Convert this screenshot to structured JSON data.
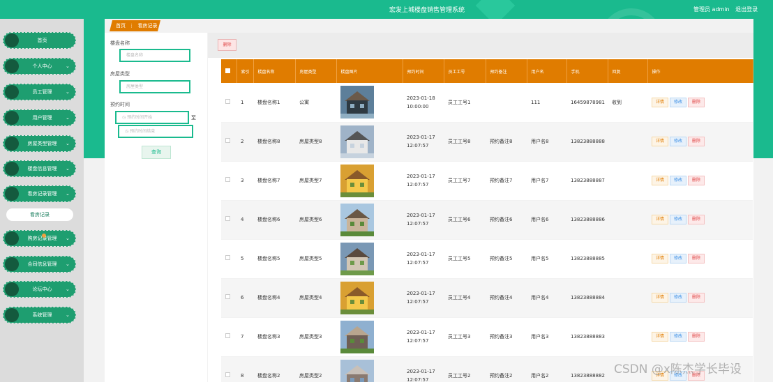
{
  "header": {
    "title": "宏发上城楼盘销售管理系统",
    "user_role": "管理员 admin",
    "logout": "退出登录"
  },
  "sidebar": {
    "items": [
      {
        "label": "首页",
        "has_chevron": false
      },
      {
        "label": "个人中心",
        "has_chevron": true
      },
      {
        "label": "员工管理",
        "has_chevron": true
      },
      {
        "label": "用户管理",
        "has_chevron": true
      },
      {
        "label": "房屋类型管理",
        "has_chevron": true
      },
      {
        "label": "楼盘信息管理",
        "has_chevron": true
      },
      {
        "label": "看房记录管理",
        "has_chevron": true
      },
      {
        "label": "购房记录管理",
        "has_chevron": true
      },
      {
        "label": "合同信息管理",
        "has_chevron": true
      },
      {
        "label": "论坛中心",
        "has_chevron": true
      },
      {
        "label": "系统管理",
        "has_chevron": true
      }
    ],
    "sub_item": "看房记录"
  },
  "breadcrumb": {
    "home": "首页",
    "separator": "⋮",
    "current": "看房记录"
  },
  "search": {
    "name_label": "楼盘名称",
    "name_placeholder": "楼盘名称",
    "type_label": "房屋类型",
    "type_placeholder": "房屋类型",
    "time_label": "预约时间",
    "time_start_placeholder": "预约时间开始",
    "time_to": "至",
    "time_end_placeholder": "预约时间结束",
    "button": "查询"
  },
  "toolbar": {
    "delete": "删除"
  },
  "table": {
    "headers": [
      "索引",
      "楼盘名称",
      "房屋类型",
      "楼盘图片",
      "预约时间",
      "员工工号",
      "预约备注",
      "用户名",
      "手机",
      "回复",
      "操作"
    ],
    "actions": {
      "detail": "详情",
      "edit": "修改",
      "delete": "删除"
    },
    "rows": [
      {
        "index": "1",
        "name": "楼盘名称1",
        "type": "公寓",
        "time": "2023-01-18 10:00:00",
        "staff": "员工工号1",
        "remark": "",
        "user": "111",
        "phone": "16459878981",
        "reply": "收到",
        "img": "img1"
      },
      {
        "index": "2",
        "name": "楼盘名称8",
        "type": "房屋类型8",
        "time": "2023-01-17 12:07:57",
        "staff": "员工工号8",
        "remark": "预约备注8",
        "user": "用户名8",
        "phone": "13823888888",
        "reply": "",
        "img": "img2"
      },
      {
        "index": "3",
        "name": "楼盘名称7",
        "type": "房屋类型7",
        "time": "2023-01-17 12:07:57",
        "staff": "员工工号7",
        "remark": "预约备注7",
        "user": "用户名7",
        "phone": "13823888887",
        "reply": "",
        "img": "img3"
      },
      {
        "index": "4",
        "name": "楼盘名称6",
        "type": "房屋类型6",
        "time": "2023-01-17 12:07:57",
        "staff": "员工工号6",
        "remark": "预约备注6",
        "user": "用户名6",
        "phone": "13823888886",
        "reply": "",
        "img": "img4"
      },
      {
        "index": "5",
        "name": "楼盘名称5",
        "type": "房屋类型5",
        "time": "2023-01-17 12:07:57",
        "staff": "员工工号5",
        "remark": "预约备注5",
        "user": "用户名5",
        "phone": "13823888885",
        "reply": "",
        "img": "img5"
      },
      {
        "index": "6",
        "name": "楼盘名称4",
        "type": "房屋类型4",
        "time": "2023-01-17 12:07:57",
        "staff": "员工工号4",
        "remark": "预约备注4",
        "user": "用户名4",
        "phone": "13823888884",
        "reply": "",
        "img": "img3"
      },
      {
        "index": "7",
        "name": "楼盘名称3",
        "type": "房屋类型3",
        "time": "2023-01-17 12:07:57",
        "staff": "员工工号3",
        "remark": "预约备注3",
        "user": "用户名3",
        "phone": "13823888883",
        "reply": "",
        "img": "img6"
      },
      {
        "index": "8",
        "name": "楼盘名称2",
        "type": "房屋类型2",
        "time": "2023-01-17 12:07:57",
        "staff": "员工工号2",
        "remark": "预约备注2",
        "user": "用户名2",
        "phone": "13823888882",
        "reply": "",
        "img": "img7"
      }
    ]
  },
  "watermark": "CSDN @x陈杰学长毕设",
  "colors": {
    "primary": "#1aba8e",
    "header_orange": "#e07c00",
    "sidebar_item": "#1e9e70"
  }
}
